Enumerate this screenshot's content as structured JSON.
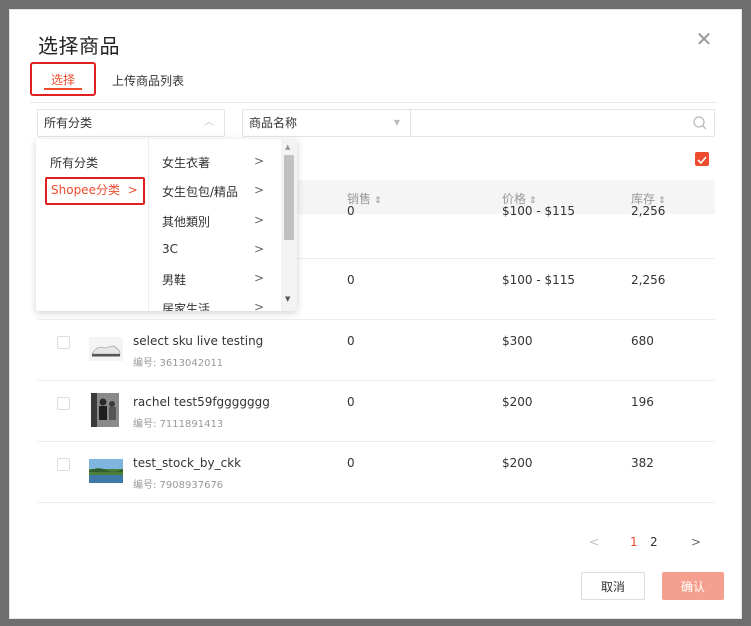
{
  "modal": {
    "title": "选择商品",
    "close": "✕"
  },
  "tabs": [
    {
      "label": "选择"
    },
    {
      "label": "上传商品列表"
    }
  ],
  "filters": {
    "category_value": "所有分类",
    "search_type_value": "商品名称",
    "search_placeholder": ""
  },
  "table": {
    "headers": {
      "sales": "销售",
      "price": "价格",
      "stock": "库存"
    },
    "rows": [
      {
        "name": "",
        "sku": "",
        "sales": "0",
        "price": "$100 - $115",
        "stock": "2,256"
      },
      {
        "name": "",
        "sku": "",
        "sales": "0",
        "price": "$100 - $115",
        "stock": "2,256"
      },
      {
        "name": "select sku live testing",
        "sku": "编号: 3613042011",
        "sales": "0",
        "price": "$300",
        "stock": "680"
      },
      {
        "name": "rachel test59fggggggg",
        "sku": "编号: 7111891413",
        "sales": "0",
        "price": "$200",
        "stock": "196"
      },
      {
        "name": "test_stock_by_ckk",
        "sku": "编号: 7908937676",
        "sales": "0",
        "price": "$200",
        "stock": "382"
      }
    ]
  },
  "dropdown": {
    "col1": [
      {
        "label": "所有分类"
      },
      {
        "label": "Shopee分类"
      }
    ],
    "col2": [
      {
        "label": "女生衣著"
      },
      {
        "label": "女生包包/精品"
      },
      {
        "label": "其他類別"
      },
      {
        "label": "3C"
      },
      {
        "label": "男鞋"
      },
      {
        "label": "居家生活"
      }
    ],
    "arrow": ">"
  },
  "pagination": {
    "prev": "<",
    "pages": [
      "1",
      "2"
    ],
    "next": ">"
  },
  "buttons": {
    "cancel": "取消",
    "confirm": "确认"
  },
  "colors": {
    "accent": "#ee4d2d",
    "highlight_border": "#e02020",
    "confirm_bg": "#f5a08e"
  }
}
